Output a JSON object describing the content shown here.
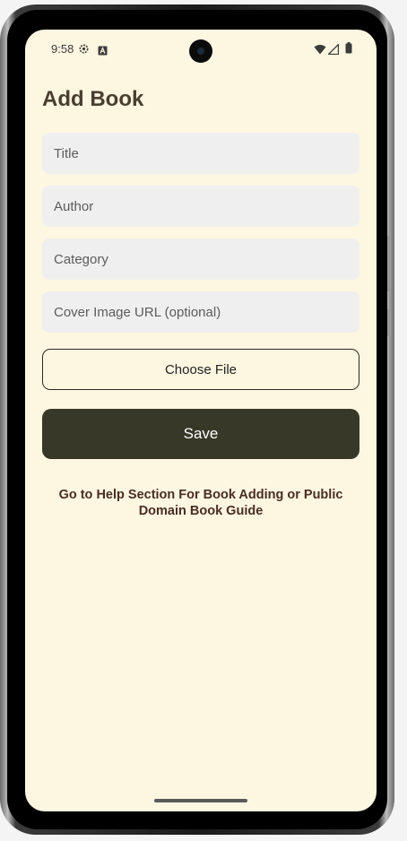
{
  "status_bar": {
    "time": "9:58",
    "left_icons": [
      "settings-icon",
      "keyboard-a-icon"
    ],
    "right_icons": [
      "wifi-icon",
      "cellular-signal-icon",
      "battery-icon"
    ]
  },
  "page": {
    "title": "Add Book"
  },
  "form": {
    "title_placeholder": "Title",
    "author_placeholder": "Author",
    "category_placeholder": "Category",
    "cover_url_placeholder": "Cover Image URL (optional)",
    "choose_file_label": "Choose File",
    "save_label": "Save"
  },
  "help": {
    "link_text": "Go to Help Section For Book Adding or Public Domain Book Guide"
  },
  "colors": {
    "background": "#fdf6e1",
    "field_background": "#f0efef",
    "save_button": "#383828",
    "title_text": "#4a3e30",
    "help_text": "#4a2e22"
  }
}
